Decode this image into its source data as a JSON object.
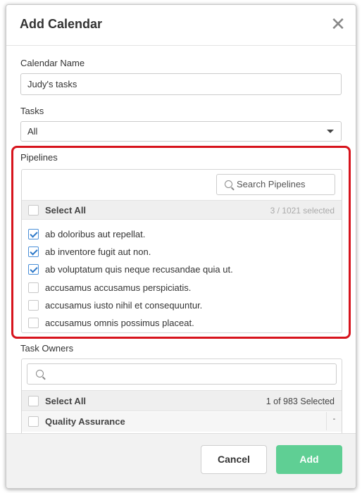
{
  "dialog": {
    "title": "Add Calendar",
    "close_icon": "close-icon"
  },
  "calendar_name": {
    "label": "Calendar Name",
    "value": "Judy's tasks"
  },
  "tasks": {
    "label": "Tasks",
    "selected": "All"
  },
  "pipelines": {
    "label": "Pipelines",
    "search_placeholder": "Search Pipelines",
    "select_all_label": "Select All",
    "selected_count": "3 / 1021 selected",
    "items": [
      {
        "label": "ab doloribus aut repellat.",
        "checked": true
      },
      {
        "label": "ab inventore fugit aut non.",
        "checked": true
      },
      {
        "label": "ab voluptatum quis neque recusandae quia ut.",
        "checked": true
      },
      {
        "label": "accusamus accusamus perspiciatis.",
        "checked": false
      },
      {
        "label": "accusamus iusto nihil et consequuntur.",
        "checked": false
      },
      {
        "label": "accusamus omnis possimus placeat.",
        "checked": false
      }
    ]
  },
  "task_owners": {
    "label": "Task Owners",
    "search_placeholder": "",
    "select_all_label": "Select All",
    "selected_count": "1 of 983 Selected",
    "groups": [
      {
        "label": "Quality Assurance",
        "collapse_symbol": "-"
      }
    ]
  },
  "footer": {
    "cancel_label": "Cancel",
    "add_label": "Add"
  },
  "colors": {
    "highlight": "#d7131c",
    "add_button": "#5fcf94",
    "checkbox_check": "#2d78c8"
  }
}
